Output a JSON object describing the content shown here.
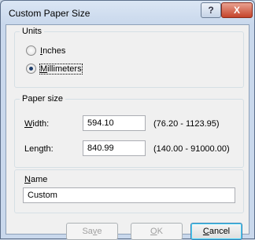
{
  "window": {
    "title": "Custom Paper Size",
    "help_glyph": "?",
    "close_glyph": "X"
  },
  "units": {
    "label": "Units",
    "options": [
      {
        "pre": "",
        "access": "I",
        "post": "nches",
        "checked": false
      },
      {
        "pre": "",
        "access": "M",
        "post": "illimeters",
        "checked": true
      }
    ]
  },
  "paper_size": {
    "label": "Paper size",
    "width": {
      "pre": "",
      "access": "W",
      "post": "idth:",
      "value": "594.10",
      "range": "(76.20 - 1123.95)"
    },
    "length": {
      "pre": "Len",
      "access": "g",
      "post": "th:",
      "value": "840.99",
      "range": "(140.00 - 91000.00)"
    }
  },
  "name": {
    "pre": "",
    "access": "N",
    "post": "ame",
    "value": "Custom"
  },
  "buttons": {
    "save": {
      "pre": "Sa",
      "access": "v",
      "post": "e"
    },
    "ok": {
      "pre": "",
      "access": "O",
      "post": "K"
    },
    "cancel": {
      "pre": "",
      "access": "C",
      "post": "ancel"
    }
  }
}
